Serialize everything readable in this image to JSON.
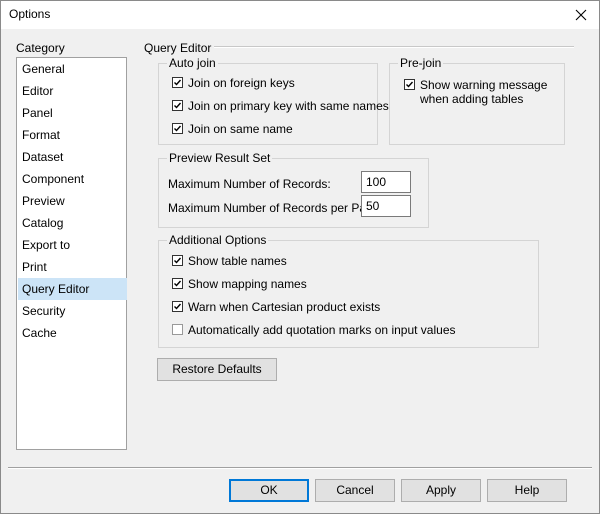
{
  "window": {
    "title": "Options"
  },
  "category": {
    "label": "Category",
    "items": [
      "General",
      "Editor",
      "Panel",
      "Format",
      "Dataset",
      "Component",
      "Preview",
      "Catalog",
      "Export to",
      "Print",
      "Query Editor",
      "Security",
      "Cache"
    ],
    "selected": "Query Editor"
  },
  "query_editor": {
    "title": "Query Editor",
    "auto_join": {
      "label": "Auto join",
      "options": [
        {
          "label": "Join on foreign keys",
          "checked": true
        },
        {
          "label": "Join on primary key with same names",
          "checked": true
        },
        {
          "label": "Join on same name",
          "checked": true
        }
      ]
    },
    "pre_join": {
      "label": "Pre-join",
      "option_line1": "Show warning message",
      "option_line2": "when adding tables",
      "checked": true
    },
    "preview": {
      "label": "Preview Result Set",
      "max_records_label": "Maximum Number of Records:",
      "max_records_value": "100",
      "max_per_page_label": "Maximum Number of Records per Page:",
      "max_per_page_value": "50"
    },
    "additional": {
      "label": "Additional Options",
      "options": [
        {
          "label": "Show table names",
          "checked": true
        },
        {
          "label": "Show mapping names",
          "checked": true
        },
        {
          "label": "Warn when Cartesian product exists",
          "checked": true
        },
        {
          "label": "Automatically add quotation marks on input values",
          "checked": false
        }
      ]
    },
    "restore_label": "Restore Defaults"
  },
  "buttons": {
    "ok": "OK",
    "cancel": "Cancel",
    "apply": "Apply",
    "help": "Help"
  }
}
